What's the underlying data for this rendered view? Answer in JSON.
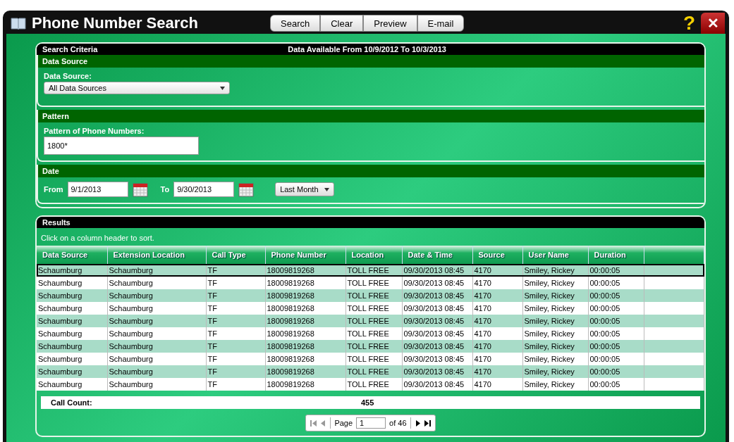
{
  "window": {
    "title": "Phone Number Search"
  },
  "toolbar": [
    "Search",
    "Clear",
    "Preview",
    "E-mail"
  ],
  "help": "?",
  "close": "✕",
  "criteria": {
    "title": "Search Criteria",
    "availability": "Data Available From 10/9/2012 To 10/3/2013",
    "data_source": {
      "header": "Data Source",
      "label": "Data Source:",
      "value": "All Data Sources"
    },
    "pattern": {
      "header": "Pattern",
      "label": "Pattern of Phone Numbers:",
      "value": "1800*"
    },
    "date": {
      "header": "Date",
      "from_label": "From",
      "from": "9/1/2013",
      "to_label": "To",
      "to": "9/30/2013",
      "range": "Last Month"
    }
  },
  "results": {
    "title": "Results",
    "hint": "Click on a column header to sort.",
    "columns": [
      "Data Source",
      "Extension Location",
      "Call Type",
      "Phone Number",
      "Location",
      "Date & Time",
      "Source",
      "User Name",
      "Duration"
    ],
    "rows": [
      {
        "selected": true,
        "cells": [
          "Schaumburg",
          "Schaumburg",
          "TF",
          "18009819268",
          "TOLL FREE",
          "09/30/2013 08:45",
          "4170",
          "Smiley, Rickey",
          "00:00:05"
        ]
      },
      {
        "selected": false,
        "cells": [
          "Schaumburg",
          "Schaumburg",
          "TF",
          "18009819268",
          "TOLL FREE",
          "09/30/2013 08:45",
          "4170",
          "Smiley, Rickey",
          "00:00:05"
        ]
      },
      {
        "selected": false,
        "cells": [
          "Schaumburg",
          "Schaumburg",
          "TF",
          "18009819268",
          "TOLL FREE",
          "09/30/2013 08:45",
          "4170",
          "Smiley, Rickey",
          "00:00:05"
        ]
      },
      {
        "selected": false,
        "cells": [
          "Schaumburg",
          "Schaumburg",
          "TF",
          "18009819268",
          "TOLL FREE",
          "09/30/2013 08:45",
          "4170",
          "Smiley, Rickey",
          "00:00:05"
        ]
      },
      {
        "selected": false,
        "cells": [
          "Schaumburg",
          "Schaumburg",
          "TF",
          "18009819268",
          "TOLL FREE",
          "09/30/2013 08:45",
          "4170",
          "Smiley, Rickey",
          "00:00:05"
        ]
      },
      {
        "selected": false,
        "cells": [
          "Schaumburg",
          "Schaumburg",
          "TF",
          "18009819268",
          "TOLL FREE",
          "09/30/2013 08:45",
          "4170",
          "Smiley, Rickey",
          "00:00:05"
        ]
      },
      {
        "selected": false,
        "cells": [
          "Schaumburg",
          "Schaumburg",
          "TF",
          "18009819268",
          "TOLL FREE",
          "09/30/2013 08:45",
          "4170",
          "Smiley, Rickey",
          "00:00:05"
        ]
      },
      {
        "selected": false,
        "cells": [
          "Schaumburg",
          "Schaumburg",
          "TF",
          "18009819268",
          "TOLL FREE",
          "09/30/2013 08:45",
          "4170",
          "Smiley, Rickey",
          "00:00:05"
        ]
      },
      {
        "selected": false,
        "cells": [
          "Schaumburg",
          "Schaumburg",
          "TF",
          "18009819268",
          "TOLL FREE",
          "09/30/2013 08:45",
          "4170",
          "Smiley, Rickey",
          "00:00:05"
        ]
      },
      {
        "selected": false,
        "cells": [
          "Schaumburg",
          "Schaumburg",
          "TF",
          "18009819268",
          "TOLL FREE",
          "09/30/2013 08:45",
          "4170",
          "Smiley, Rickey",
          "00:00:05"
        ]
      }
    ],
    "call_count_label": "Call Count:",
    "call_count": "455",
    "pager": {
      "page_label": "Page",
      "page": "1",
      "of": "of 46"
    }
  }
}
